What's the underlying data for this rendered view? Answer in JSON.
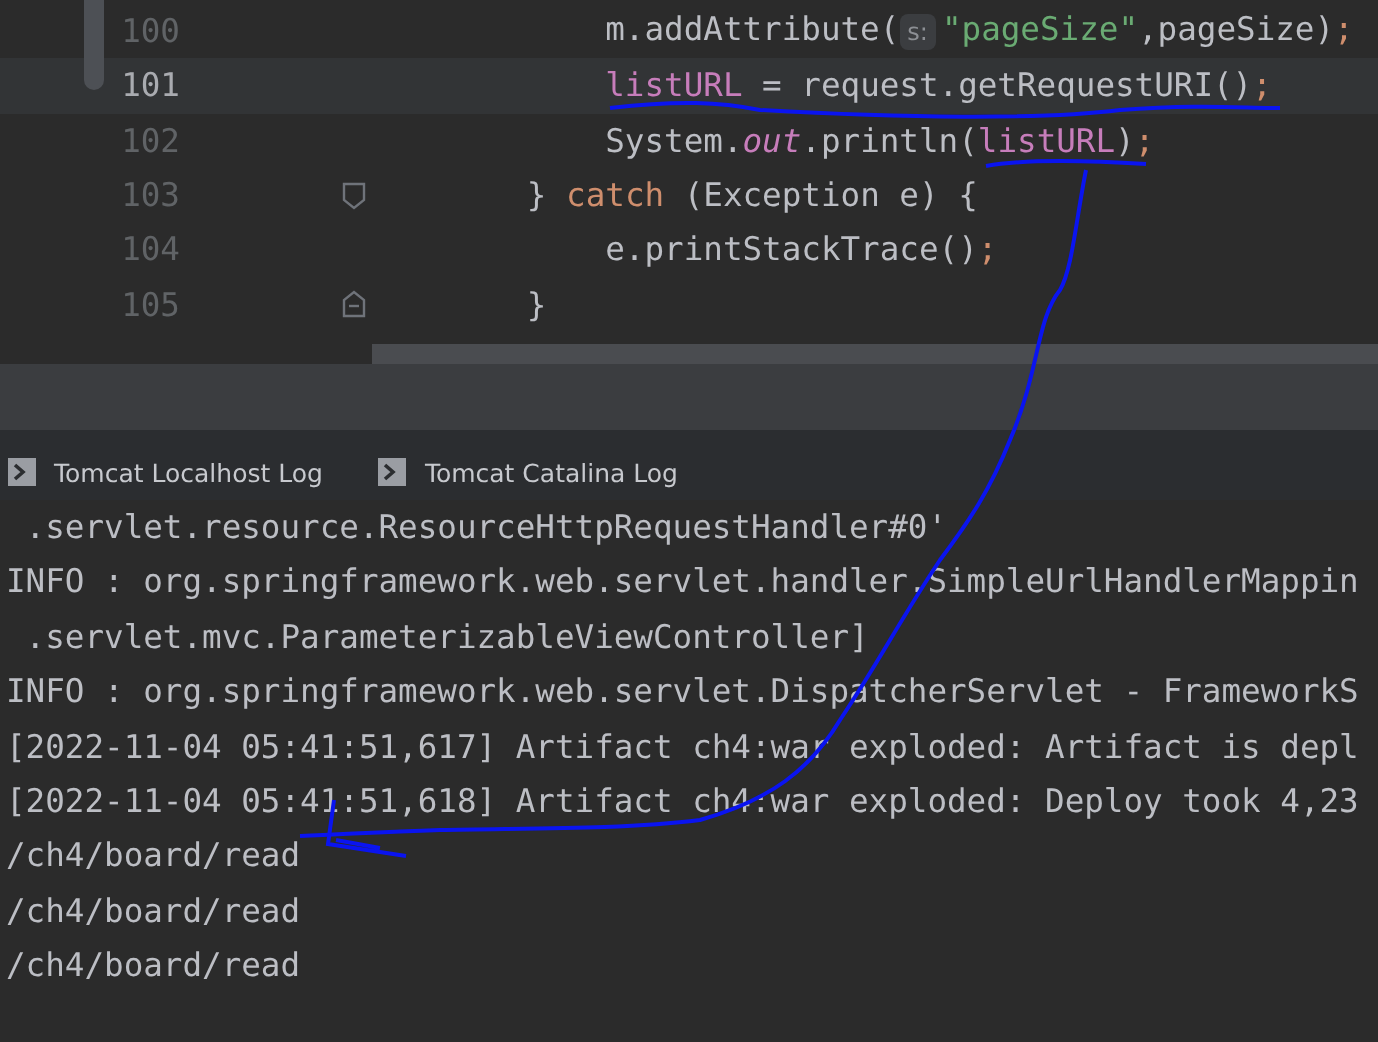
{
  "editor": {
    "lines": [
      {
        "number": "100",
        "selected": false,
        "kind": "plain",
        "tokens": [
          {
            "kind": "code",
            "text": "            m.addAttribute("
          },
          {
            "kind": "hint",
            "text": "s:"
          },
          {
            "kind": "string",
            "text": "\"pageSize\""
          },
          {
            "kind": "code",
            "text": ",pageSize)"
          },
          {
            "kind": "punct",
            "text": ";"
          }
        ]
      },
      {
        "number": "101",
        "selected": true,
        "kind": "plain",
        "tokens": [
          {
            "kind": "field",
            "text": "            listURL"
          },
          {
            "kind": "code",
            "text": " = request.getRequestURI()"
          },
          {
            "kind": "punct",
            "text": ";"
          }
        ]
      },
      {
        "number": "102",
        "selected": false,
        "kind": "plain",
        "tokens": [
          {
            "kind": "code",
            "text": "            System."
          },
          {
            "kind": "static",
            "text": "out"
          },
          {
            "kind": "code",
            "text": ".println("
          },
          {
            "kind": "field",
            "text": "listURL"
          },
          {
            "kind": "code",
            "text": ")"
          },
          {
            "kind": "punct",
            "text": ";"
          }
        ]
      },
      {
        "number": "103",
        "selected": false,
        "kind": "fold-start",
        "tokens": [
          {
            "kind": "code",
            "text": "        } "
          },
          {
            "kind": "keyword",
            "text": "catch"
          },
          {
            "kind": "code",
            "text": " (Exception e) {"
          }
        ]
      },
      {
        "number": "104",
        "selected": false,
        "kind": "plain",
        "tokens": [
          {
            "kind": "code",
            "text": "            e.printStackTrace()"
          },
          {
            "kind": "punct",
            "text": ";"
          }
        ]
      },
      {
        "number": "105",
        "selected": false,
        "kind": "fold-end",
        "tokens": [
          {
            "kind": "code",
            "text": "        }"
          }
        ]
      }
    ]
  },
  "tabs": [
    {
      "label": "Tomcat Localhost Log"
    },
    {
      "label": "Tomcat Catalina Log"
    }
  ],
  "console": {
    "lines": [
      " .servlet.resource.ResourceHttpRequestHandler#0'",
      "INFO : org.springframework.web.servlet.handler.SimpleUrlHandlerMappin",
      " .servlet.mvc.ParameterizableViewController]",
      "INFO : org.springframework.web.servlet.DispatcherServlet - FrameworkS",
      "[2022-11-04 05:41:51,617] Artifact ch4:war exploded: Artifact is depl",
      "[2022-11-04 05:41:51,618] Artifact ch4:war exploded: Deploy took 4,23",
      "/ch4/board/read",
      "/ch4/board/read",
      "/ch4/board/read"
    ]
  }
}
